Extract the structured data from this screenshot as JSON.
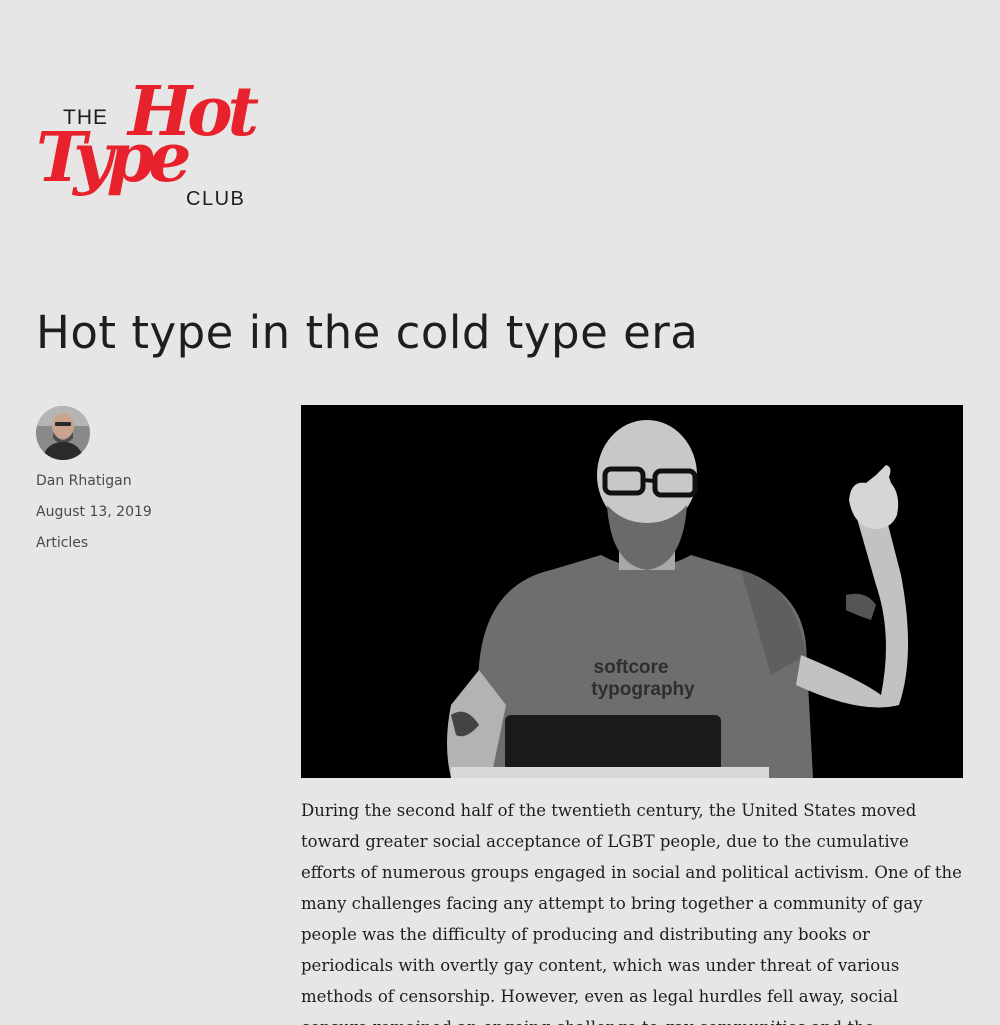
{
  "site": {
    "logo": {
      "the": "THE",
      "hot": "Hot",
      "type": "Type",
      "club": "CLUB"
    }
  },
  "article": {
    "title": "Hot type in the cold type era",
    "author": "Dan Rhatigan",
    "date": "August 13, 2019",
    "category": "Articles",
    "hero_shirt_text": [
      "softcore",
      "typography"
    ],
    "paragraphs": [
      "During the second half of the twentieth century, the United States moved toward greater social acceptance of LGBT people, due to the cumulative efforts of numerous groups engaged in social and political activism. One of the many challenges facing any attempt to bring together a community of gay people was the difficulty of producing and distributing any books or periodicals with overtly gay content, which was under threat of various methods of censorship. However, even as legal hurdles fell away, social censure remained an ongoing challenge to gay communities and the"
    ]
  },
  "colors": {
    "background": "#e6e6e6",
    "brand_red": "#e8222c",
    "text": "#1e1e1e",
    "meta_text": "#4a4a4a"
  }
}
